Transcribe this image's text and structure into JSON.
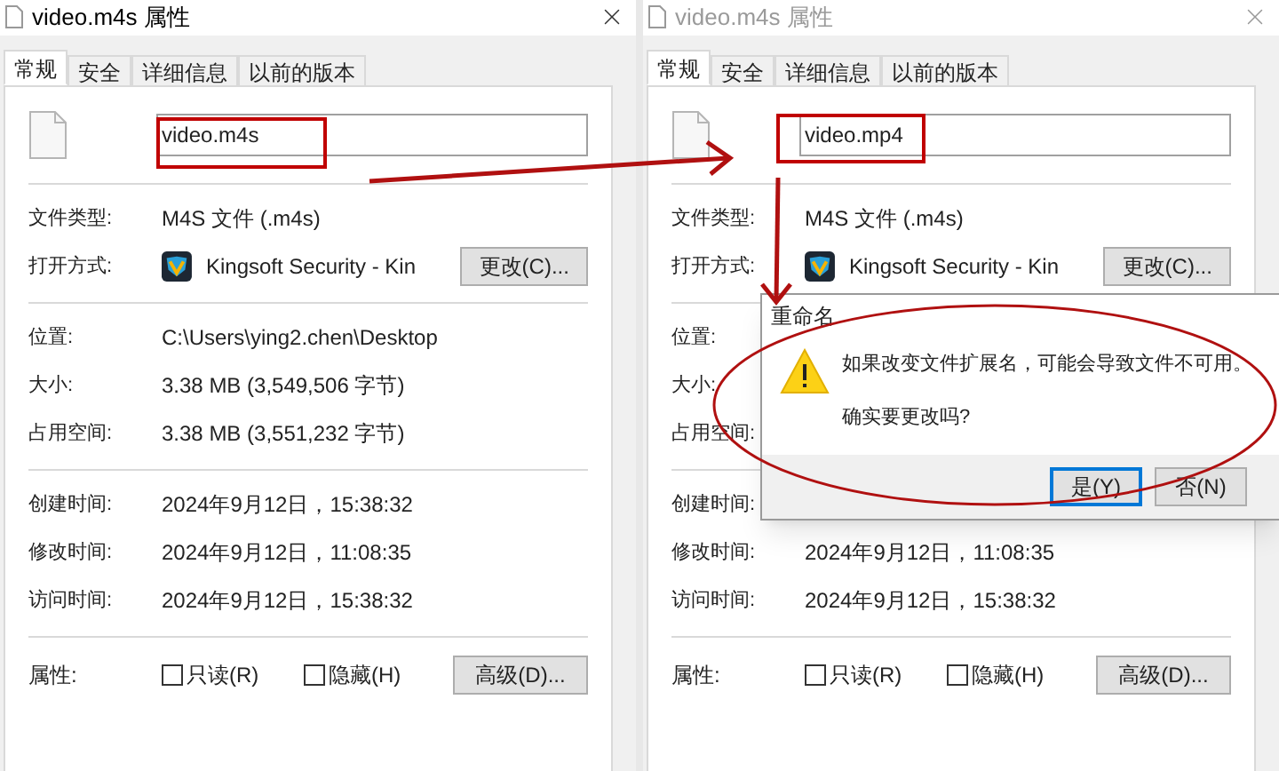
{
  "windows": [
    {
      "title": "video.m4s 属性",
      "active": true,
      "tabs": [
        {
          "label": "常规",
          "selected": true
        },
        {
          "label": "安全",
          "selected": false
        },
        {
          "label": "详细信息",
          "selected": false
        },
        {
          "label": "以前的版本",
          "selected": false
        }
      ],
      "filename": "video.m4s",
      "sections": [
        [
          {
            "kind": "text",
            "label": "文件类型:",
            "value": "M4S 文件 (.m4s)"
          },
          {
            "kind": "app",
            "label": "打开方式:",
            "value": "Kingsoft Security - Kin",
            "button": "更改(C)..."
          }
        ],
        [
          {
            "kind": "text",
            "label": "位置:",
            "value": "C:\\Users\\ying2.chen\\Desktop"
          },
          {
            "kind": "text",
            "label": "大小:",
            "value": "3.38 MB (3,549,506 字节)"
          },
          {
            "kind": "text",
            "label": "占用空间:",
            "value": "3.38 MB (3,551,232 字节)"
          }
        ],
        [
          {
            "kind": "text",
            "label": "创建时间:",
            "value": "2024年9月12日，15:38:32"
          },
          {
            "kind": "text",
            "label": "修改时间:",
            "value": "2024年9月12日，11:08:35"
          },
          {
            "kind": "text",
            "label": "访问时间:",
            "value": "2024年9月12日，15:38:32"
          }
        ]
      ],
      "attributes": {
        "label": "属性:",
        "checks": [
          {
            "label": "只读(R)",
            "checked": false
          },
          {
            "label": "隐藏(H)",
            "checked": false
          }
        ],
        "button": "高级(D)..."
      }
    },
    {
      "title": "video.m4s 属性",
      "active": false,
      "tabs": [
        {
          "label": "常规",
          "selected": true
        },
        {
          "label": "安全",
          "selected": false
        },
        {
          "label": "详细信息",
          "selected": false
        },
        {
          "label": "以前的版本",
          "selected": false
        }
      ],
      "filename": "video.mp4",
      "sections": [
        [
          {
            "kind": "text",
            "label": "文件类型:",
            "value": "M4S 文件 (.m4s)"
          },
          {
            "kind": "app",
            "label": "打开方式:",
            "value": "Kingsoft Security - Kin",
            "button": "更改(C)..."
          }
        ],
        [
          {
            "kind": "text",
            "label": "位置:"
          },
          {
            "kind": "text",
            "label": "大小:"
          },
          {
            "kind": "text",
            "label": "占用空间:"
          }
        ],
        [
          {
            "kind": "text",
            "label": "创建时间:"
          },
          {
            "kind": "text",
            "label": "修改时间:",
            "value": "2024年9月12日，11:08:35"
          },
          {
            "kind": "text",
            "label": "访问时间:",
            "value": "2024年9月12日，15:38:32"
          }
        ]
      ],
      "attributes": {
        "label": "属性:",
        "checks": [
          {
            "label": "只读(R)",
            "checked": false
          },
          {
            "label": "隐藏(H)",
            "checked": false
          }
        ],
        "button": "高级(D)..."
      },
      "dialog": {
        "title": "重命名",
        "message": "如果改变文件扩展名，可能会导致文件不可用。",
        "question": "确实要更改吗?",
        "buttons": [
          {
            "label": "是(Y)",
            "selected": true
          },
          {
            "label": "否(N)",
            "selected": false
          }
        ]
      }
    }
  ]
}
